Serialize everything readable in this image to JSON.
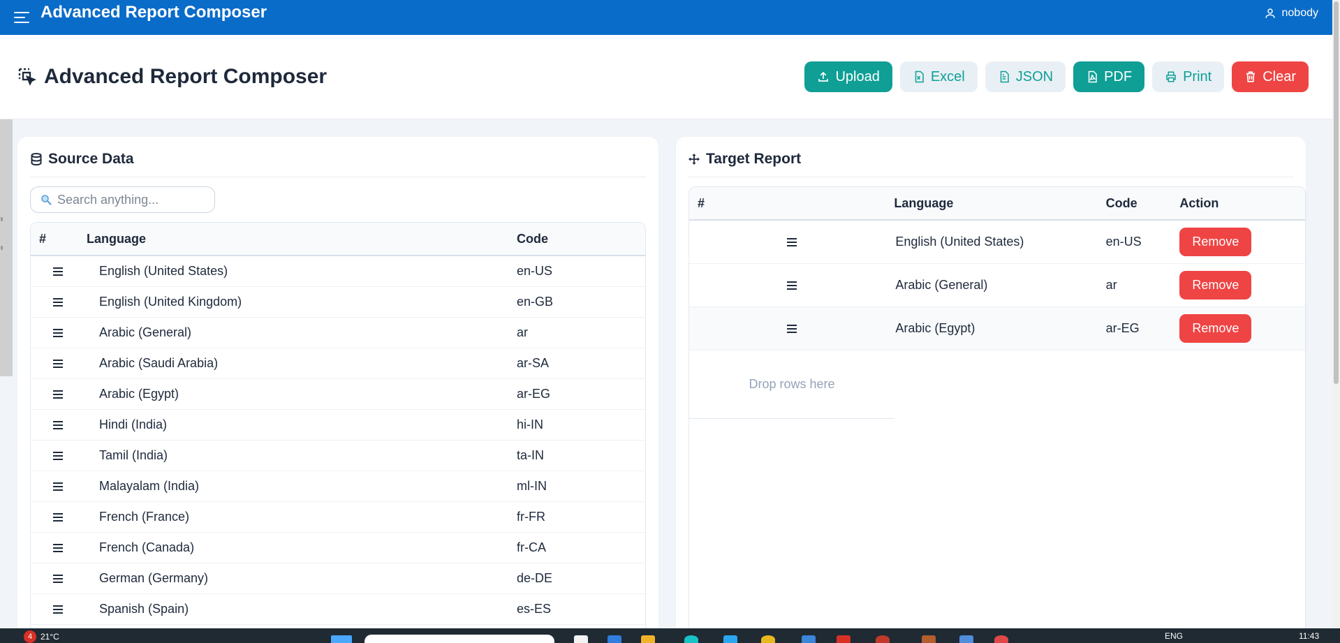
{
  "appbar": {
    "title": "Advanced Report Composer",
    "user": "nobody"
  },
  "page": {
    "title": "Advanced Report Composer"
  },
  "actions": [
    {
      "label": "Upload",
      "icon": "upload-icon",
      "style": "teal"
    },
    {
      "label": "Excel",
      "icon": "excel-file-icon",
      "style": "light"
    },
    {
      "label": "JSON",
      "icon": "json-file-icon",
      "style": "light"
    },
    {
      "label": "PDF",
      "icon": "pdf-file-icon",
      "style": "teal"
    },
    {
      "label": "Print",
      "icon": "print-icon",
      "style": "light"
    },
    {
      "label": "Clear",
      "icon": "trash-icon",
      "style": "red"
    }
  ],
  "source": {
    "title": "Source Data",
    "search_placeholder": "Search anything...",
    "columns": {
      "hash": "#",
      "language": "Language",
      "code": "Code"
    },
    "rows": [
      {
        "language": "English (United States)",
        "code": "en-US"
      },
      {
        "language": "English (United Kingdom)",
        "code": "en-GB"
      },
      {
        "language": "Arabic (General)",
        "code": "ar"
      },
      {
        "language": "Arabic (Saudi Arabia)",
        "code": "ar-SA"
      },
      {
        "language": "Arabic (Egypt)",
        "code": "ar-EG"
      },
      {
        "language": "Hindi (India)",
        "code": "hi-IN"
      },
      {
        "language": "Tamil (India)",
        "code": "ta-IN"
      },
      {
        "language": "Malayalam (India)",
        "code": "ml-IN"
      },
      {
        "language": "French (France)",
        "code": "fr-FR"
      },
      {
        "language": "French (Canada)",
        "code": "fr-CA"
      },
      {
        "language": "German (Germany)",
        "code": "de-DE"
      },
      {
        "language": "Spanish (Spain)",
        "code": "es-ES"
      }
    ]
  },
  "target": {
    "title": "Target Report",
    "columns": {
      "hash": "#",
      "language": "Language",
      "code": "Code",
      "action": "Action"
    },
    "rows": [
      {
        "language": "English (United States)",
        "code": "en-US",
        "action": "Remove"
      },
      {
        "language": "Arabic (General)",
        "code": "ar",
        "action": "Remove"
      },
      {
        "language": "Arabic (Egypt)",
        "code": "ar-EG",
        "action": "Remove"
      }
    ],
    "drop_text": "Drop rows here"
  },
  "taskbar": {
    "badge": "4",
    "weather": "21°C",
    "lang": "ENG",
    "time": "11:43"
  },
  "colors": {
    "appbar": "#0a6cc9",
    "teal": "#0f9f95",
    "red": "#ef4444"
  }
}
